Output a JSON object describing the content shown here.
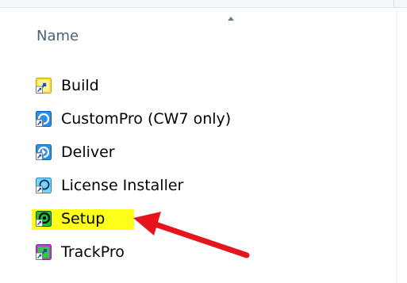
{
  "column_header": {
    "label": "Name",
    "sort_indicator": "sort-ascending-icon"
  },
  "files": [
    {
      "name": "Build",
      "icon": "build-shortcut-icon",
      "colors": {
        "frame": "#c9a000",
        "fill": "#ffe24a",
        "glyph": "#1f4fb8"
      }
    },
    {
      "name": "CustomPro (CW7 only)",
      "icon": "custompro-shortcut-icon",
      "colors": {
        "frame": "#0a5fb0",
        "fill": "#2f8fe6",
        "glyph": "#ffffff"
      }
    },
    {
      "name": "Deliver",
      "icon": "deliver-shortcut-icon",
      "colors": {
        "frame": "#0a5fb0",
        "fill": "#2f8fe6",
        "glyph": "#ffffff"
      }
    },
    {
      "name": "License Installer",
      "icon": "license-installer-shortcut-icon",
      "colors": {
        "frame": "#1c86c8",
        "fill": "#7fd3f2",
        "glyph": "#0a3f7a"
      }
    },
    {
      "name": "Setup",
      "icon": "setup-shortcut-icon",
      "colors": {
        "frame": "#0b4f1a",
        "fill": "#22c13a",
        "glyph": "#111111"
      }
    },
    {
      "name": "TrackPro",
      "icon": "trackpro-shortcut-icon",
      "colors": {
        "frame": "#7a2a8a",
        "fill": "#3ec24a",
        "glyph": "#1f4fb8"
      }
    }
  ],
  "highlight": {
    "item": "Setup",
    "color": "#ffff1a"
  },
  "annotation": {
    "type": "arrow",
    "color": "#e8141b",
    "points_to": "Setup"
  }
}
